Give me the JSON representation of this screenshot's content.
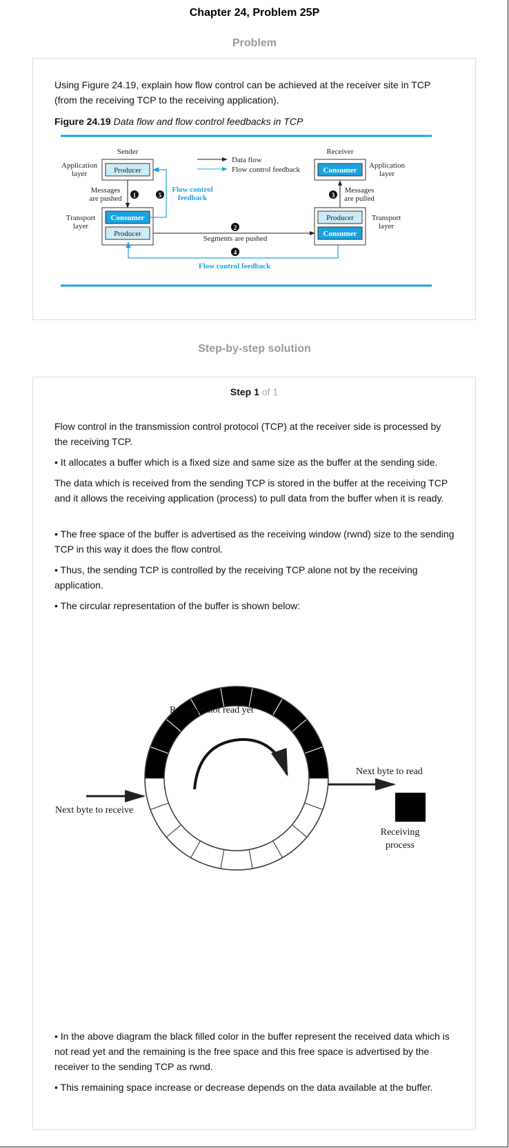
{
  "header": {
    "chapter_title": "Chapter 24, Problem 25P",
    "problem_heading": "Problem",
    "solution_heading": "Step-by-step solution"
  },
  "problem": {
    "text": "Using Figure 24.19, explain how flow control can be achieved at the receiver site in TCP (from the receiving TCP to the receiving application).",
    "figure_number": "Figure 24.19",
    "figure_caption": "Data flow and flow control feedbacks in TCP",
    "figure": {
      "sender_label": "Sender",
      "receiver_label": "Receiver",
      "app_layer_left": [
        "Application",
        "layer"
      ],
      "app_layer_right": [
        "Application",
        "layer"
      ],
      "transport_layer_left": [
        "Transport",
        "layer"
      ],
      "transport_layer_right": [
        "Transport",
        "layer"
      ],
      "producer": "Producer",
      "consumer": "Consumer",
      "messages_pushed": [
        "Messages",
        "are pushed"
      ],
      "messages_pulled": [
        "Messages",
        "are pulled"
      ],
      "legend_data_flow": "Data flow",
      "legend_feedback": "Flow control feedback",
      "flow_control_feedback_top": [
        "Flow control",
        "feedback"
      ],
      "segments_pushed": "Segments are pushed",
      "flow_control_feedback_bottom": "Flow control feedback",
      "markers": [
        "1",
        "2",
        "3",
        "4",
        "5"
      ]
    }
  },
  "solution": {
    "step_label": "Step 1",
    "step_of": "of 1",
    "paragraphs": [
      "Flow control in the transmission control protocol (TCP) at the receiver side is processed by the receiving TCP.",
      "• It allocates a buffer which is a fixed size and same size as the buffer at the sending side.",
      "The data which is received from the sending TCP is stored in the buffer at the receiving TCP and it allows the receiving application (process) to pull data from the buffer when it is ready.",
      "• The free space of the buffer is advertised as the receiving window (rwnd) size to the sending TCP in this way it does the flow control.",
      "• Thus, the sending TCP is controlled by the receiving TCP alone not by the receiving application.",
      "• The circular representation of the buffer is shown below:",
      "• In the above diagram the black filled color in the buffer represent the received data which is not read yet and the remaining is the free space and this free space is advertised by the receiver to the sending TCP as rwnd.",
      "• This remaining space increase or decrease depends on the data available at the buffer."
    ],
    "buffer_diagram": {
      "received_not_read": "Received not read yet",
      "next_byte_to_read": "Next byte to read",
      "next_byte_to_receive": "Next byte to receive",
      "receiving_process": [
        "Receiving",
        "process"
      ]
    }
  },
  "colors": {
    "accent_blue": "#1aa3e0",
    "light_blue": "#cdeaf8",
    "heading_gray": "#999999"
  }
}
